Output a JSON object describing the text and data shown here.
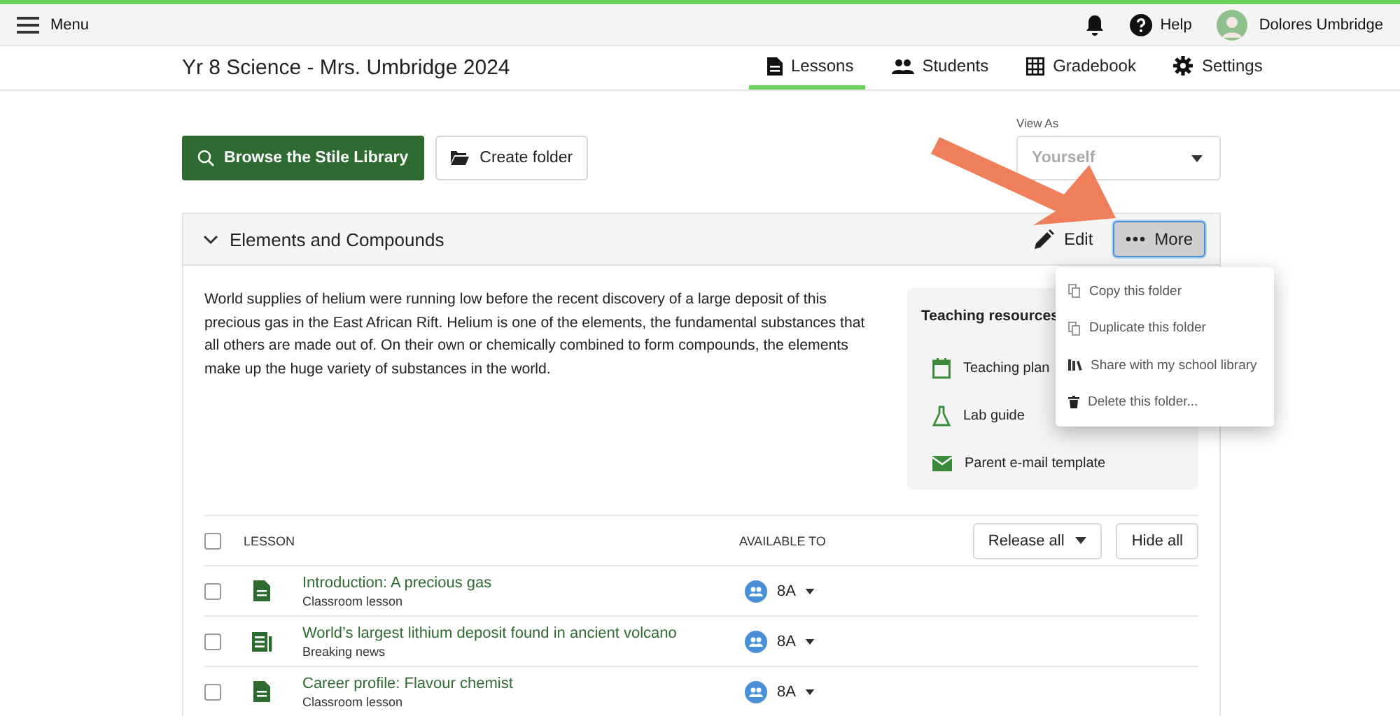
{
  "top_bar": {
    "menu_label": "Menu",
    "help_label": "Help",
    "user_name": "Dolores Umbridge"
  },
  "course": {
    "title": "Yr 8 Science - Mrs. Umbridge 2024",
    "tabs": [
      {
        "label": "Lessons",
        "selected": true
      },
      {
        "label": "Students",
        "selected": false
      },
      {
        "label": "Gradebook",
        "selected": false
      },
      {
        "label": "Settings",
        "selected": false
      }
    ]
  },
  "toolbar": {
    "browse_button": "Browse the Stile Library",
    "create_folder_button": "Create folder",
    "view_as": {
      "label": "View As",
      "placeholder": "Yourself"
    }
  },
  "folder": {
    "title": "Elements and Compounds",
    "expanded": true,
    "edit_label": "Edit",
    "more_label": "More",
    "more_open": true,
    "description": "World supplies of helium were running low before the recent discovery of a large deposit of this precious gas in the East African Rift. Helium is one of the elements, the fundamental substances that all others are made out of. On their own or chemically combined to form compounds, the elements make up the huge variety of substances in the world.",
    "resources": {
      "title": "Teaching resources",
      "items": [
        {
          "label": "Teaching plan"
        },
        {
          "label": "Lab guide"
        },
        {
          "label": "Parent e-mail template"
        }
      ]
    },
    "more_menu": [
      {
        "label": "Copy this folder"
      },
      {
        "label": "Duplicate this folder"
      },
      {
        "label": "Share with my school library"
      },
      {
        "label": "Delete this folder..."
      }
    ],
    "table": {
      "columns": [
        "LESSON",
        "AVAILABLE TO"
      ],
      "release_all": "Release all",
      "hide_all": "Hide all",
      "all_checked": false,
      "rows": [
        {
          "kind": "lesson",
          "title": "Introduction: A precious gas",
          "type": "Classroom lesson",
          "group": "8A",
          "checked": false
        },
        {
          "kind": "news",
          "title": "World’s largest lithium deposit found in ancient volcano",
          "type": "Breaking news",
          "group": "8A",
          "checked": false
        },
        {
          "kind": "lesson",
          "title": "Career profile: Flavour chemist",
          "type": "Classroom lesson",
          "group": "8A",
          "checked": false
        }
      ]
    }
  }
}
